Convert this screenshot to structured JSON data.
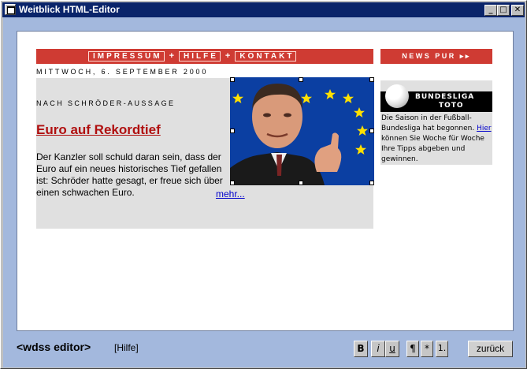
{
  "window": {
    "title": "Weitblick HTML-Editor"
  },
  "window_buttons": {
    "minimize": "_",
    "maximize": "□",
    "close": "✕"
  },
  "page": {
    "nav": {
      "items": [
        "IMPRESSUM",
        "HILFE",
        "KONTAKT"
      ],
      "separator": "+"
    },
    "news_bar": {
      "label": "NEWS PUR ▸▸"
    },
    "date": "MITTWOCH, 6. SEPTEMBER 2000",
    "article": {
      "kicker": "NACH SCHRÖDER-AUSSAGE",
      "headline": "Euro auf Rekordtief",
      "teaser": "Der Kanzler soll schuld daran sein, dass der Euro auf ein neues historisches Tief gefallen ist: Schröder hatte gesagt, er freue sich über einen schwachen Euro.",
      "more": "mehr..."
    },
    "sidebar": {
      "logo_line1": "BUNDESLIGA",
      "logo_line2": "TOTO",
      "text_before": "Die Saison in der Fußball-Bundesliga hat begonnen.",
      "link": "Hier",
      "text_after": "können Sie Woche für Woche Ihre Tipps abgeben und gewinnen."
    }
  },
  "bottom": {
    "logo": "<wdss editor>",
    "help": "[Hilfe]",
    "buttons": {
      "bold": "B",
      "italic": "i",
      "underline": "u",
      "paragraph": "¶",
      "bullet": "*",
      "numbered": "1.",
      "back": "zurück"
    }
  },
  "colors": {
    "title_bar": "#0a246a",
    "frame": "#a3b8dd",
    "accent_red": "#cf3b33",
    "headline": "#b01010",
    "link": "#0000cc",
    "content_box": "#e0e0e0",
    "photo_bg": "#0b3fa2",
    "star": "#ffe000"
  }
}
